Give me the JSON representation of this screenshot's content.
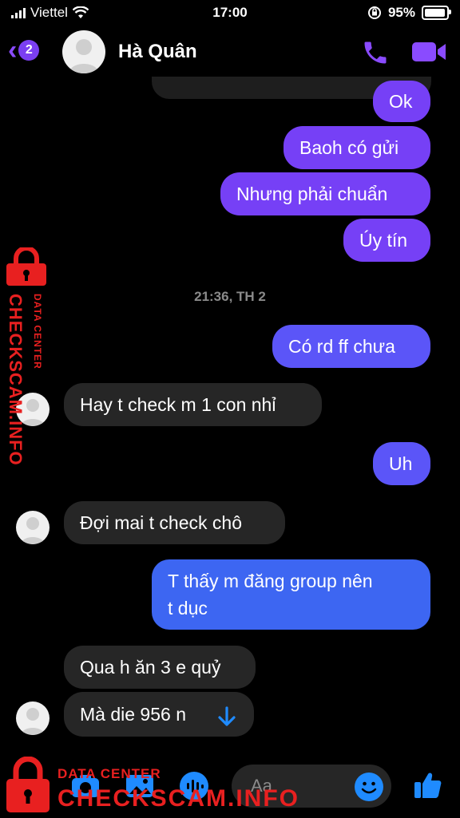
{
  "status": {
    "carrier": "Viettel",
    "time": "17:00",
    "battery": "95%",
    "battery_level": 0.95
  },
  "header": {
    "back_count": "2",
    "contact_name": "Hà Quân"
  },
  "messages": {
    "m1": "Ok",
    "m2": "Baoh có gửi",
    "m3": "Nhưng phải chuẩn",
    "m4": "Úy tín",
    "timestamp": "21:36, TH 2",
    "m5": "Có rd ff chưa",
    "m6": "Hay t check m 1 con nhỉ",
    "m7": "Uh",
    "m8": "Đợi mai t check chô",
    "m9_line1": "T thấy m đăng group nên",
    "m9_line2": "t dục",
    "m10": "Qua h ăn 3 e quỷ",
    "m11": "Mà die 956 n"
  },
  "composer": {
    "placeholder": "Aa"
  },
  "watermark": {
    "small": "DATA CENTER",
    "large": "CHECKSCAM.INFO"
  },
  "colors": {
    "accent": "#7640f6",
    "in_bubble": "#262626",
    "blue": "#1f8bff",
    "watermark": "#e82020"
  }
}
